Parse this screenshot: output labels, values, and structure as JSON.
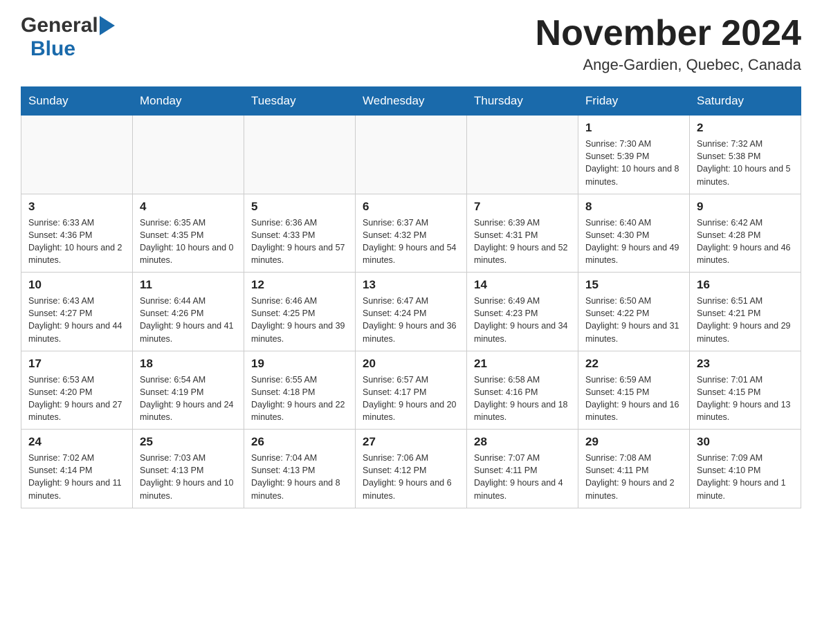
{
  "header": {
    "month_title": "November 2024",
    "location": "Ange-Gardien, Quebec, Canada",
    "logo_general": "General",
    "logo_blue": "Blue"
  },
  "weekdays": [
    "Sunday",
    "Monday",
    "Tuesday",
    "Wednesday",
    "Thursday",
    "Friday",
    "Saturday"
  ],
  "weeks": [
    [
      {
        "day": "",
        "info": ""
      },
      {
        "day": "",
        "info": ""
      },
      {
        "day": "",
        "info": ""
      },
      {
        "day": "",
        "info": ""
      },
      {
        "day": "",
        "info": ""
      },
      {
        "day": "1",
        "info": "Sunrise: 7:30 AM\nSunset: 5:39 PM\nDaylight: 10 hours and 8 minutes."
      },
      {
        "day": "2",
        "info": "Sunrise: 7:32 AM\nSunset: 5:38 PM\nDaylight: 10 hours and 5 minutes."
      }
    ],
    [
      {
        "day": "3",
        "info": "Sunrise: 6:33 AM\nSunset: 4:36 PM\nDaylight: 10 hours and 2 minutes."
      },
      {
        "day": "4",
        "info": "Sunrise: 6:35 AM\nSunset: 4:35 PM\nDaylight: 10 hours and 0 minutes."
      },
      {
        "day": "5",
        "info": "Sunrise: 6:36 AM\nSunset: 4:33 PM\nDaylight: 9 hours and 57 minutes."
      },
      {
        "day": "6",
        "info": "Sunrise: 6:37 AM\nSunset: 4:32 PM\nDaylight: 9 hours and 54 minutes."
      },
      {
        "day": "7",
        "info": "Sunrise: 6:39 AM\nSunset: 4:31 PM\nDaylight: 9 hours and 52 minutes."
      },
      {
        "day": "8",
        "info": "Sunrise: 6:40 AM\nSunset: 4:30 PM\nDaylight: 9 hours and 49 minutes."
      },
      {
        "day": "9",
        "info": "Sunrise: 6:42 AM\nSunset: 4:28 PM\nDaylight: 9 hours and 46 minutes."
      }
    ],
    [
      {
        "day": "10",
        "info": "Sunrise: 6:43 AM\nSunset: 4:27 PM\nDaylight: 9 hours and 44 minutes."
      },
      {
        "day": "11",
        "info": "Sunrise: 6:44 AM\nSunset: 4:26 PM\nDaylight: 9 hours and 41 minutes."
      },
      {
        "day": "12",
        "info": "Sunrise: 6:46 AM\nSunset: 4:25 PM\nDaylight: 9 hours and 39 minutes."
      },
      {
        "day": "13",
        "info": "Sunrise: 6:47 AM\nSunset: 4:24 PM\nDaylight: 9 hours and 36 minutes."
      },
      {
        "day": "14",
        "info": "Sunrise: 6:49 AM\nSunset: 4:23 PM\nDaylight: 9 hours and 34 minutes."
      },
      {
        "day": "15",
        "info": "Sunrise: 6:50 AM\nSunset: 4:22 PM\nDaylight: 9 hours and 31 minutes."
      },
      {
        "day": "16",
        "info": "Sunrise: 6:51 AM\nSunset: 4:21 PM\nDaylight: 9 hours and 29 minutes."
      }
    ],
    [
      {
        "day": "17",
        "info": "Sunrise: 6:53 AM\nSunset: 4:20 PM\nDaylight: 9 hours and 27 minutes."
      },
      {
        "day": "18",
        "info": "Sunrise: 6:54 AM\nSunset: 4:19 PM\nDaylight: 9 hours and 24 minutes."
      },
      {
        "day": "19",
        "info": "Sunrise: 6:55 AM\nSunset: 4:18 PM\nDaylight: 9 hours and 22 minutes."
      },
      {
        "day": "20",
        "info": "Sunrise: 6:57 AM\nSunset: 4:17 PM\nDaylight: 9 hours and 20 minutes."
      },
      {
        "day": "21",
        "info": "Sunrise: 6:58 AM\nSunset: 4:16 PM\nDaylight: 9 hours and 18 minutes."
      },
      {
        "day": "22",
        "info": "Sunrise: 6:59 AM\nSunset: 4:15 PM\nDaylight: 9 hours and 16 minutes."
      },
      {
        "day": "23",
        "info": "Sunrise: 7:01 AM\nSunset: 4:15 PM\nDaylight: 9 hours and 13 minutes."
      }
    ],
    [
      {
        "day": "24",
        "info": "Sunrise: 7:02 AM\nSunset: 4:14 PM\nDaylight: 9 hours and 11 minutes."
      },
      {
        "day": "25",
        "info": "Sunrise: 7:03 AM\nSunset: 4:13 PM\nDaylight: 9 hours and 10 minutes."
      },
      {
        "day": "26",
        "info": "Sunrise: 7:04 AM\nSunset: 4:13 PM\nDaylight: 9 hours and 8 minutes."
      },
      {
        "day": "27",
        "info": "Sunrise: 7:06 AM\nSunset: 4:12 PM\nDaylight: 9 hours and 6 minutes."
      },
      {
        "day": "28",
        "info": "Sunrise: 7:07 AM\nSunset: 4:11 PM\nDaylight: 9 hours and 4 minutes."
      },
      {
        "day": "29",
        "info": "Sunrise: 7:08 AM\nSunset: 4:11 PM\nDaylight: 9 hours and 2 minutes."
      },
      {
        "day": "30",
        "info": "Sunrise: 7:09 AM\nSunset: 4:10 PM\nDaylight: 9 hours and 1 minute."
      }
    ]
  ]
}
